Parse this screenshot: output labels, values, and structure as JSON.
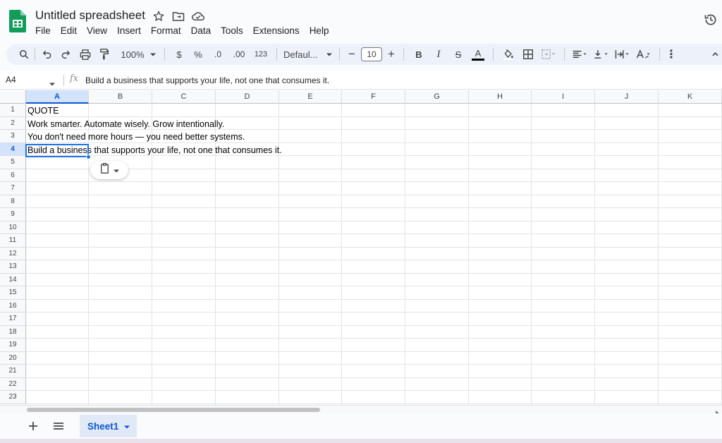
{
  "app": {
    "doc_title": "Untitled spreadsheet",
    "brand_color": "#0f9d58",
    "accent_color": "#0b57d0"
  },
  "menu": [
    "File",
    "Edit",
    "View",
    "Insert",
    "Format",
    "Data",
    "Tools",
    "Extensions",
    "Help"
  ],
  "toolbar": {
    "zoom": "100%",
    "currency": "$",
    "percent": "%",
    "decrease_decimal": ".0",
    "increase_decimal": ".00",
    "number_format": "123",
    "font": "Defaul...",
    "font_size": "10",
    "minus": "−",
    "plus": "+",
    "bold": "B",
    "italic": "I",
    "strike": "S",
    "text_color": "A",
    "more": "⋮"
  },
  "formula_bar": {
    "cell_ref": "A4",
    "fx": "fx",
    "formula": "Build a business that supports your life, not one that consumes it."
  },
  "columns": [
    "A",
    "B",
    "C",
    "D",
    "E",
    "F",
    "G",
    "H",
    "I",
    "J",
    "K"
  ],
  "rows": [
    "1",
    "2",
    "3",
    "4",
    "5",
    "6",
    "7",
    "8",
    "9",
    "10",
    "11",
    "12",
    "13",
    "14",
    "15",
    "16",
    "17",
    "18",
    "19",
    "20",
    "21",
    "22",
    "23"
  ],
  "cells": {
    "A1": "QUOTE",
    "A2": "Work smarter. Automate wisely. Grow intentionally.",
    "A3": "You don't need more hours — you need better systems.",
    "A4": "Build a business that supports your life, not one that consumes it."
  },
  "selection": {
    "cell": "A4",
    "column": "A",
    "row": "4"
  },
  "sheets": [
    {
      "label": "Sheet1",
      "active": true
    }
  ]
}
